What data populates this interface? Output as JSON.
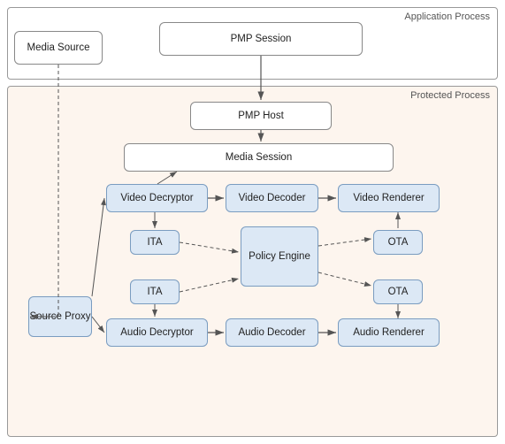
{
  "regions": {
    "appProcess": "Application Process",
    "protectedProcess": "Protected Process"
  },
  "boxes": {
    "mediaSource": "Media Source",
    "pmpSession": "PMP Session",
    "pmpHost": "PMP Host",
    "mediaSession": "Media Session",
    "videoDecryptor": "Video Decryptor",
    "videoDecoder": "Video Decoder",
    "videoRenderer": "Video Renderer",
    "audioDecryptor": "Audio Decryptor",
    "audioDecoder": "Audio Decoder",
    "audioRenderer": "Audio Renderer",
    "policyEngine": "Policy Engine",
    "ita1": "ITA",
    "ita2": "ITA",
    "ota1": "OTA",
    "ota2": "OTA",
    "sourceProxy": "Source Proxy"
  },
  "colors": {
    "boxFill": "#dce8f5",
    "boxBorder": "#7a9cc0",
    "protectedBg": "#fdf5ee",
    "arrowColor": "#555"
  }
}
